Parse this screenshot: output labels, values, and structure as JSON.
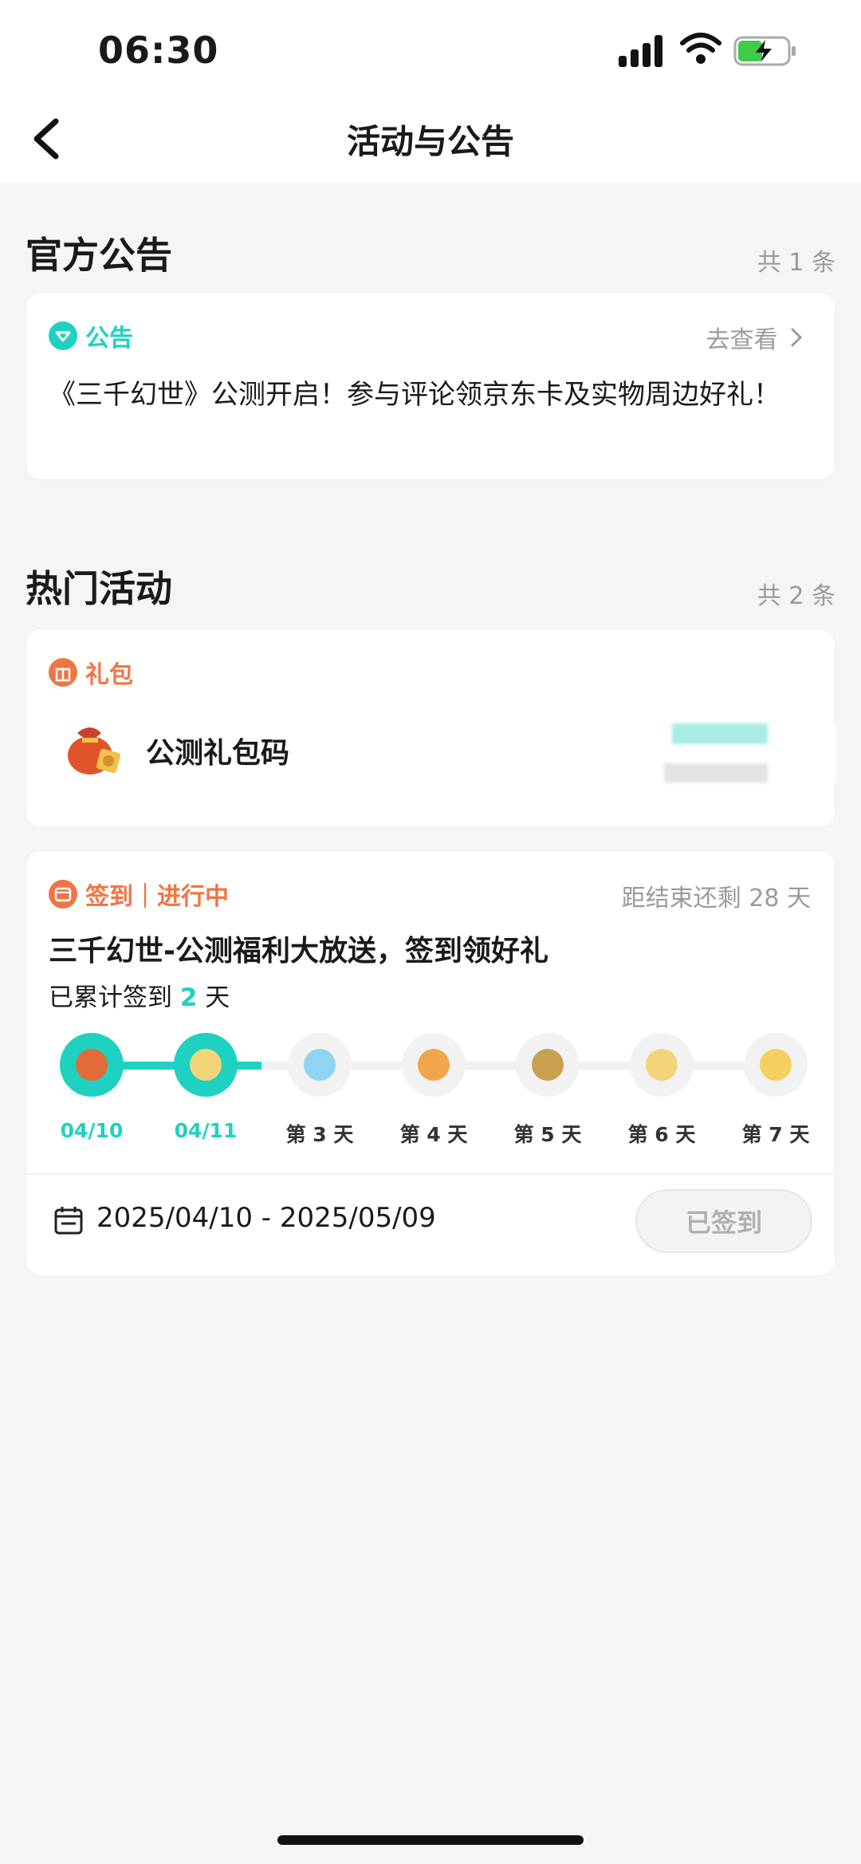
{
  "status_bar": {
    "time": "06:30"
  },
  "header": {
    "title": "活动与公告"
  },
  "official": {
    "title": "官方公告",
    "count": "共 1 条",
    "card": {
      "tag": "公告",
      "link": "去查看",
      "text": "《三千幻世》公测开启！参与评论领京东卡及实物周边好礼！"
    }
  },
  "hot": {
    "title": "热门活动",
    "count": "共 2 条",
    "gift_card": {
      "tag": "礼包",
      "name": "公测礼包码"
    },
    "checkin_card": {
      "tag": "签到｜进行中",
      "remaining": "距结束还剩 28 天",
      "title": "三千幻世-公测福利大放送，签到领好礼",
      "progress_prefix": "已累计签到",
      "progress_days": "2",
      "progress_suffix": "天",
      "days_signed": 2,
      "steps": [
        "04/10",
        "04/11",
        "第 3 天",
        "第 4 天",
        "第 5 天",
        "第 6 天",
        "第 7 天"
      ],
      "date_range": "2025/04/10 - 2025/05/09",
      "button": "已签到"
    }
  },
  "colors": {
    "accent": "#1ed1c0",
    "orange": "#f07545"
  }
}
